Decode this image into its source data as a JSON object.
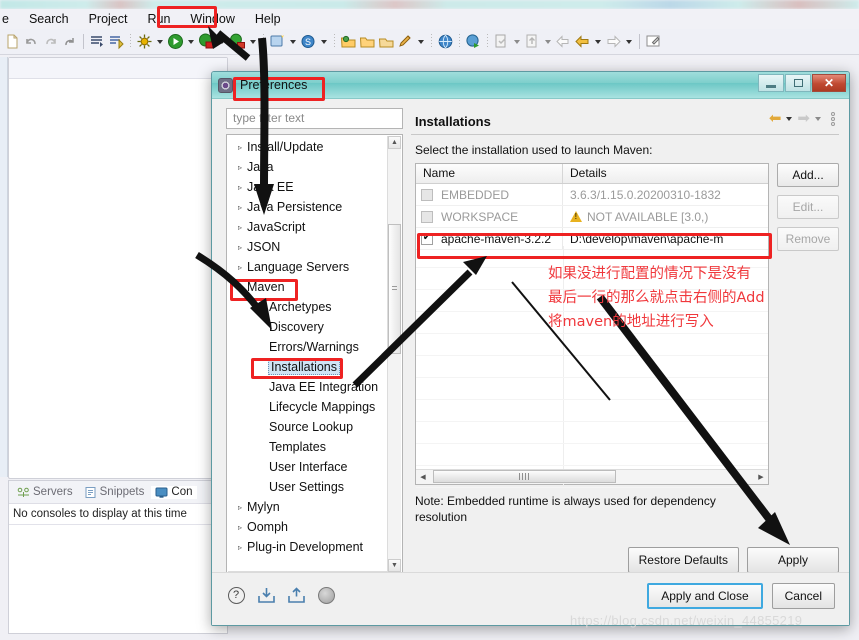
{
  "ide": {
    "menu_items": [
      "e",
      "Search",
      "Project",
      "Run",
      "Window",
      "Help"
    ],
    "editor_tab_label": "",
    "bottom_panel": {
      "tabs": [
        "Servers",
        "Snippets",
        "Con"
      ],
      "message": "No consoles to display at this time"
    }
  },
  "dialog": {
    "title": "Preferences",
    "window_buttons": {
      "minimize": "–",
      "maximize": "❐",
      "close": "✕"
    },
    "filter": {
      "placeholder": "type filter text",
      "value": ""
    },
    "tree": [
      {
        "label": "Install/Update",
        "arrow": "▹",
        "indent": 0,
        "selected": false
      },
      {
        "label": "Java",
        "arrow": "▹",
        "indent": 0,
        "selected": false
      },
      {
        "label": "Java EE",
        "arrow": "▹",
        "indent": 0,
        "selected": false
      },
      {
        "label": "Java Persistence",
        "arrow": "▹",
        "indent": 0,
        "selected": false
      },
      {
        "label": "JavaScript",
        "arrow": "▹",
        "indent": 0,
        "selected": false
      },
      {
        "label": "JSON",
        "arrow": "▹",
        "indent": 0,
        "selected": false
      },
      {
        "label": "Language Servers",
        "arrow": "▹",
        "indent": 0,
        "selected": false
      },
      {
        "label": "Maven",
        "arrow": "▾",
        "indent": 0,
        "selected": false
      },
      {
        "label": "Archetypes",
        "arrow": "",
        "indent": 1,
        "selected": false
      },
      {
        "label": "Discovery",
        "arrow": "",
        "indent": 1,
        "selected": false
      },
      {
        "label": "Errors/Warnings",
        "arrow": "",
        "indent": 1,
        "selected": false
      },
      {
        "label": "Installations",
        "arrow": "",
        "indent": 1,
        "selected": true
      },
      {
        "label": "Java EE Integration",
        "arrow": "",
        "indent": 1,
        "selected": false
      },
      {
        "label": "Lifecycle Mappings",
        "arrow": "",
        "indent": 1,
        "selected": false
      },
      {
        "label": "Source Lookup",
        "arrow": "",
        "indent": 1,
        "selected": false
      },
      {
        "label": "Templates",
        "arrow": "",
        "indent": 1,
        "selected": false
      },
      {
        "label": "User Interface",
        "arrow": "",
        "indent": 1,
        "selected": false
      },
      {
        "label": "User Settings",
        "arrow": "",
        "indent": 1,
        "selected": false
      },
      {
        "label": "Mylyn",
        "arrow": "▹",
        "indent": 0,
        "selected": false
      },
      {
        "label": "Oomph",
        "arrow": "▹",
        "indent": 0,
        "selected": false
      },
      {
        "label": "Plug-in Development",
        "arrow": "▹",
        "indent": 0,
        "selected": false
      }
    ],
    "page": {
      "title": "Installations",
      "description": "Select the installation used to launch Maven:",
      "table": {
        "columns": [
          "Name",
          "Details"
        ],
        "rows": [
          {
            "checked": false,
            "enabled": false,
            "name": "EMBEDDED",
            "details": "3.6.3/1.15.0.20200310-1832",
            "warning": false
          },
          {
            "checked": false,
            "enabled": false,
            "name": "WORKSPACE",
            "details": "NOT AVAILABLE [3.0,)",
            "warning": true
          },
          {
            "checked": true,
            "enabled": true,
            "name": "apache-maven-3.2.2",
            "details": "D:\\develop\\maven\\apache-m",
            "warning": false
          }
        ]
      },
      "side_buttons": [
        {
          "label": "Add...",
          "enabled": true
        },
        {
          "label": "Edit...",
          "enabled": false
        },
        {
          "label": "Remove",
          "enabled": false
        }
      ],
      "note": "Note: Embedded runtime is always used for dependency resolution",
      "restore_defaults_label": "Restore Defaults",
      "apply_label": "Apply"
    },
    "footer": {
      "apply_and_close_label": "Apply and Close",
      "cancel_label": "Cancel",
      "help_glyph": "?"
    }
  },
  "annotations": {
    "chinese_lines": [
      "如果没进行配置的情况下是没有",
      "最后一行的那么就点击右侧的Add",
      "将maven的地址进行写入"
    ],
    "highlight_color": "#ee2222",
    "text_color": "#f0383c"
  },
  "watermark": "https://blog.csdn.net/weixin_44855219"
}
